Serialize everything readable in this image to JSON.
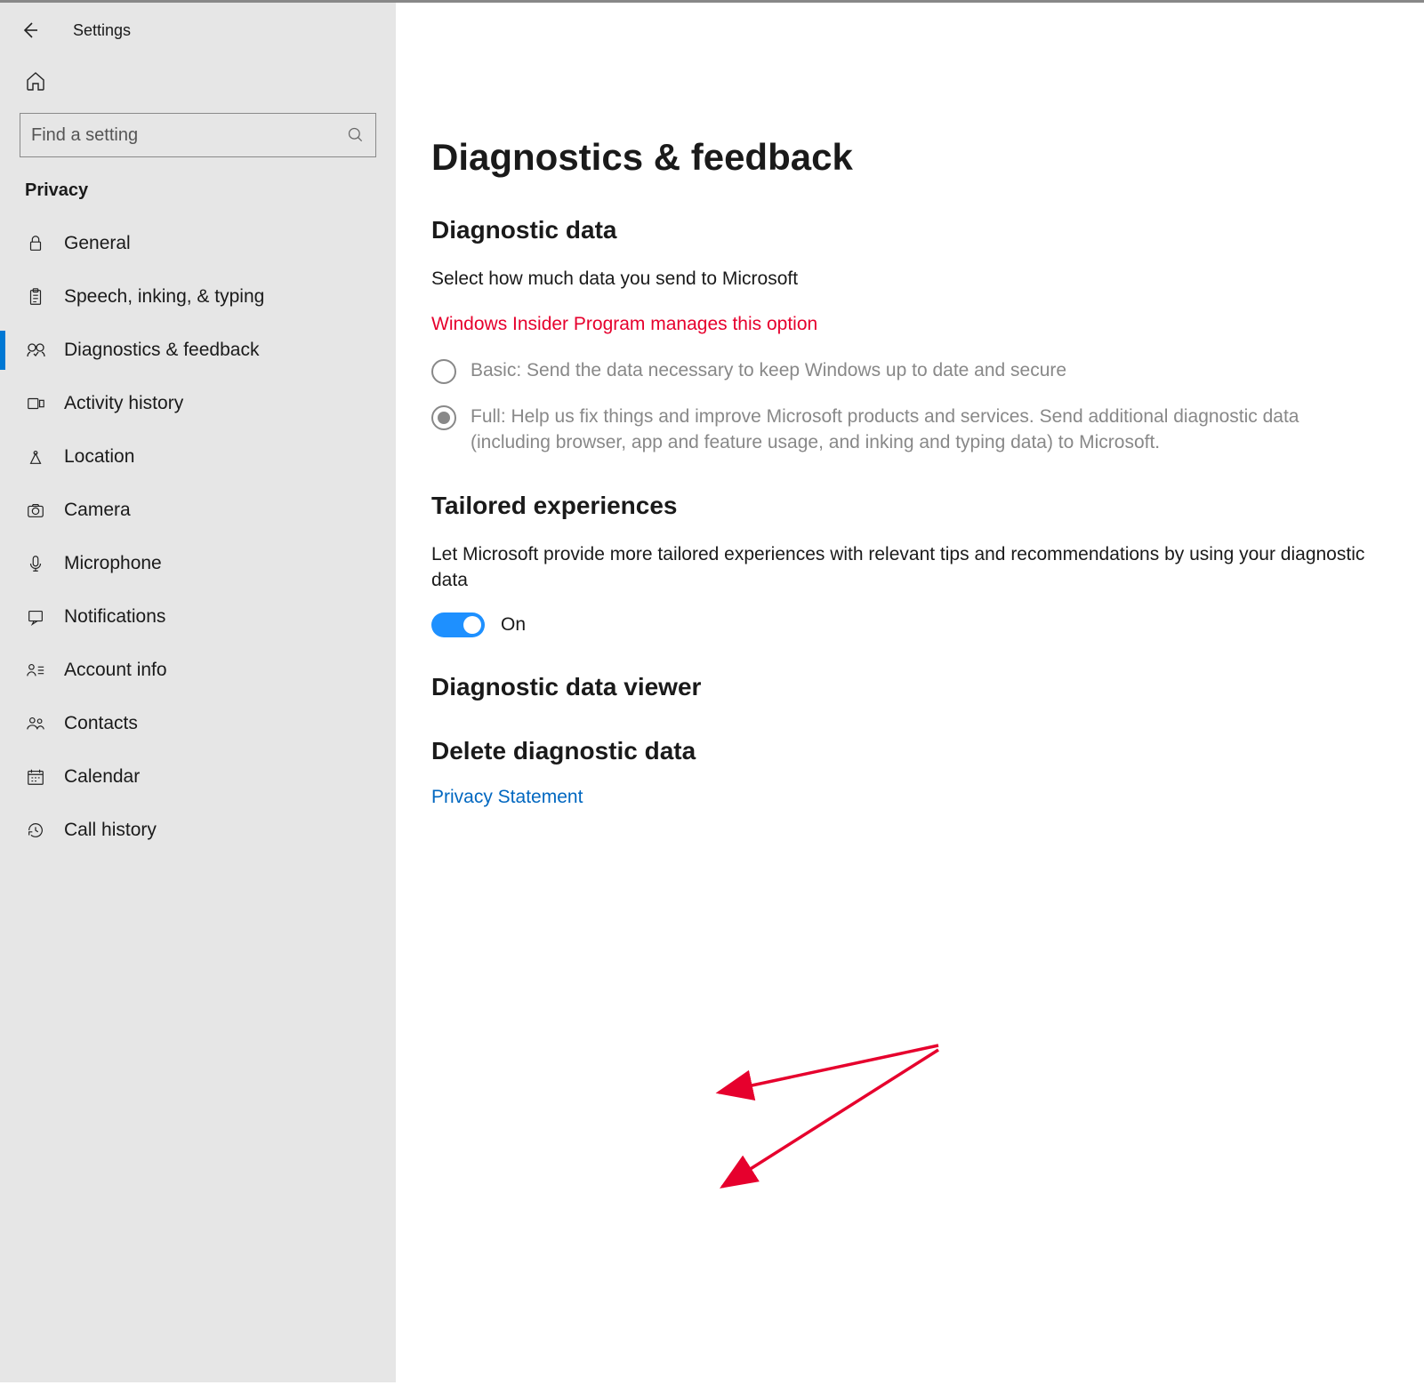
{
  "titlebar": {
    "title": "Settings"
  },
  "search": {
    "placeholder": "Find a setting"
  },
  "category": "Privacy",
  "nav": [
    {
      "key": "general",
      "label": "General",
      "icon": "lock-icon",
      "active": false
    },
    {
      "key": "speech",
      "label": "Speech, inking, & typing",
      "icon": "clipboard-icon",
      "active": false
    },
    {
      "key": "diagnostics",
      "label": "Diagnostics & feedback",
      "icon": "feedback-icon",
      "active": true
    },
    {
      "key": "activity",
      "label": "Activity history",
      "icon": "timeline-icon",
      "active": false
    },
    {
      "key": "location",
      "label": "Location",
      "icon": "location-icon",
      "active": false
    },
    {
      "key": "camera",
      "label": "Camera",
      "icon": "camera-icon",
      "active": false
    },
    {
      "key": "microphone",
      "label": "Microphone",
      "icon": "microphone-icon",
      "active": false
    },
    {
      "key": "notifications",
      "label": "Notifications",
      "icon": "notifications-icon",
      "active": false
    },
    {
      "key": "account",
      "label": "Account info",
      "icon": "account-icon",
      "active": false
    },
    {
      "key": "contacts",
      "label": "Contacts",
      "icon": "contacts-icon",
      "active": false
    },
    {
      "key": "calendar",
      "label": "Calendar",
      "icon": "calendar-icon",
      "active": false
    },
    {
      "key": "callhistory",
      "label": "Call history",
      "icon": "history-icon",
      "active": false
    }
  ],
  "main": {
    "heading": "Diagnostics & feedback",
    "section1": {
      "title": "Diagnostic data",
      "desc": "Select how much data you send to Microsoft",
      "notice": "Windows Insider Program manages this option",
      "options": [
        {
          "label": "Basic: Send the data necessary to keep Windows up to date and secure",
          "selected": false
        },
        {
          "label": "Full: Help us fix things and improve Microsoft products and services. Send additional diagnostic data (including browser, app and feature usage, and inking and typing data) to Microsoft.",
          "selected": true
        }
      ]
    },
    "section2": {
      "title": "Tailored experiences",
      "desc": "Let Microsoft provide more tailored experiences with relevant tips and recommendations by using your diagnostic data",
      "toggle_state": "On"
    },
    "section3": {
      "title": "Diagnostic data viewer"
    },
    "section4": {
      "title": "Delete diagnostic data",
      "link": "Privacy Statement"
    }
  }
}
